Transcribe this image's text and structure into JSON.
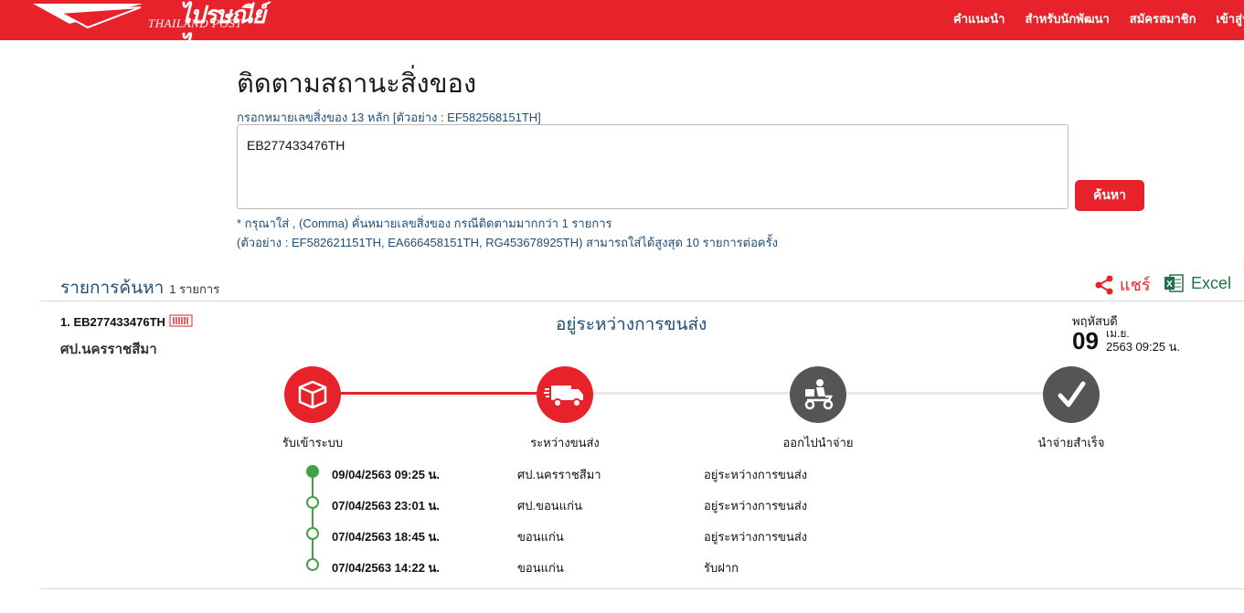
{
  "header": {
    "logo_th": "ไปรษณีย์ไทย",
    "logo_en": "THAILAND POST",
    "nav": [
      "คำแนะนำ",
      "สำหรับนักพัฒนา",
      "สมัครสมาชิก",
      "เข้าสู่ระ"
    ]
  },
  "search": {
    "title": "ติดตามสถานะสิ่งของ",
    "hint": "กรอกหมายเลขสิ่งของ 13 หลัก [ตัวอย่าง : EF582568151TH]",
    "value": "EB277433476TH",
    "button": "ค้นหา",
    "note1": "* กรุณาใส่ , (Comma) คั่นหมายเลขสิ่งของ กรณีติดตามมากกว่า 1 รายการ",
    "note2": "(ตัวอย่าง : EF582621151TH, EA666458151TH, RG453678925TH) สามารถใส่ได้สูงสุด 10 รายการต่อครั้ง"
  },
  "results": {
    "title": "รายการค้นหา",
    "count": "1 รายการ",
    "share": "แชร์",
    "excel": "Excel"
  },
  "item": {
    "number": "1. EB277433476TH",
    "office": "ศป.นครราชสีมา",
    "status": "อยู่ระหว่างการขนส่ง",
    "day_name": "พฤหัสบดี",
    "day": "09",
    "month": "เม.ย.",
    "year_time": "2563 09:25 น."
  },
  "steps": [
    {
      "label": "รับเข้าระบบ",
      "icon": "box-icon",
      "done": true
    },
    {
      "label": "ระหว่างขนส่ง",
      "icon": "truck-icon",
      "done": true
    },
    {
      "label": "ออกไปนำจ่าย",
      "icon": "scooter-icon",
      "done": false
    },
    {
      "label": "นำจ่ายสำเร็จ",
      "icon": "check-icon",
      "done": false
    }
  ],
  "timeline": [
    {
      "date": "09/04/2563 09:25 น.",
      "place": "ศป.นครราชสีมา",
      "status": "อยู่ระหว่างการขนส่ง"
    },
    {
      "date": "07/04/2563 23:01 น.",
      "place": "ศป.ขอนแก่น",
      "status": "อยู่ระหว่างการขนส่ง"
    },
    {
      "date": "07/04/2563 18:45 น.",
      "place": "ขอนแก่น",
      "status": "อยู่ระหว่างการขนส่ง"
    },
    {
      "date": "07/04/2563 14:22 น.",
      "place": "ขอนแก่น",
      "status": "รับฝาก"
    }
  ],
  "colors": {
    "brand": "#e8222a",
    "navy": "#1f4e79",
    "green": "#43a047",
    "grey": "#555555"
  }
}
